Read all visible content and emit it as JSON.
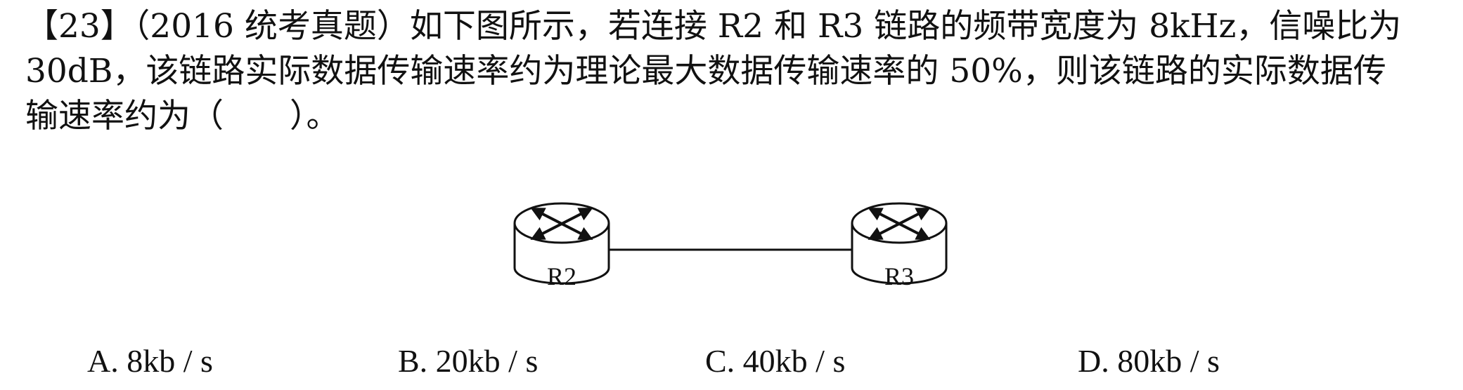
{
  "question": {
    "line1": "【23】（2016 统考真题）如下图所示，若连接 R2 和 R3 链路的频带宽度为 8kHz，信噪比为",
    "line2": "30dB，该链路实际数据传输速率约为理论最大数据传输速率的 50%，则该链路的实际数据传",
    "line3": "输速率约为（　　）。"
  },
  "diagram": {
    "router_left_label": "R2",
    "router_right_label": "R3"
  },
  "options": {
    "a": "A. 8kb / s",
    "b": "B. 20kb / s",
    "c": "C. 40kb / s",
    "d": "D. 80kb / s"
  }
}
